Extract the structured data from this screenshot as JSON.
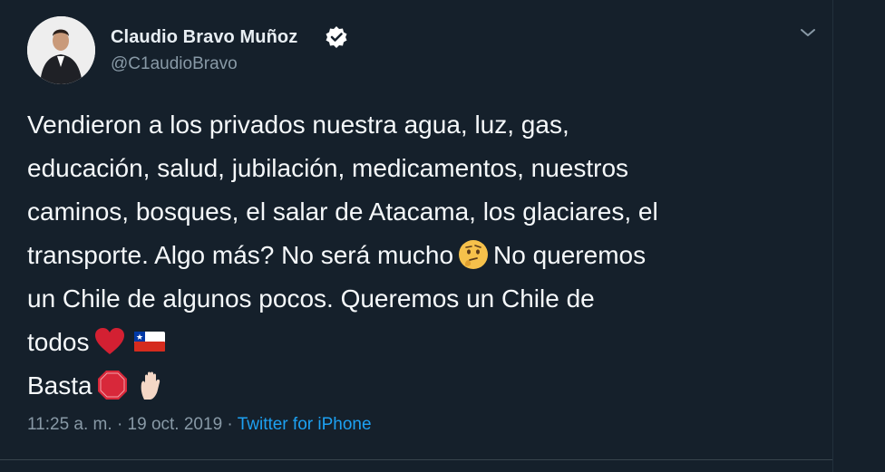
{
  "author": {
    "name": "Claudio Bravo Muñoz",
    "handle": "@C1audioBravo",
    "verified": true
  },
  "tweet": {
    "lines": [
      "Vendieron a los privados nuestra agua, luz, gas,",
      "educación, salud, jubilación, medicamentos, nuestros",
      "caminos, bosques, el salar de Atacama, los glaciares, el",
      "transporte. Algo más? No será mucho",
      "No queremos",
      "un Chile de algunos pocos. Queremos un Chile de",
      "todos",
      "Basta"
    ],
    "emojis": [
      "thinking-face-emoji",
      "red-heart-emoji",
      "chile-flag-emoji",
      "stop-sign-emoji",
      "raised-hand-emoji"
    ]
  },
  "meta": {
    "time": "11:25 a. m.",
    "separator": "·",
    "date": "19 oct. 2019",
    "source": "Twitter for iPhone"
  },
  "colors": {
    "background": "#15202b",
    "text": "#f5f8fa",
    "muted": "#8899a6",
    "link": "#1da1f2"
  }
}
